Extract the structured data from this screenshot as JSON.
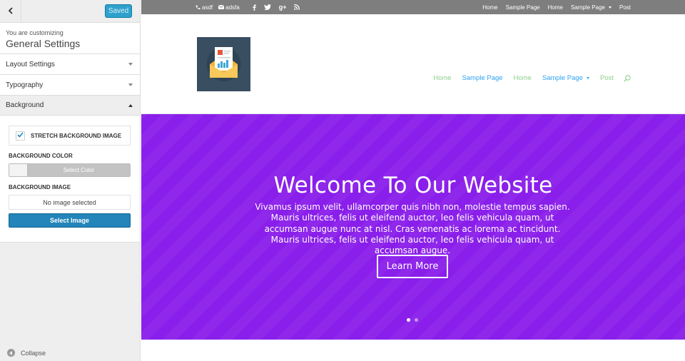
{
  "customizer": {
    "saved_label": "Saved",
    "customizing_label": "You are customizing",
    "customizing_title": "General Settings",
    "sections": [
      {
        "label": "Layout Settings"
      },
      {
        "label": "Typography"
      },
      {
        "label": "Background"
      }
    ],
    "background": {
      "stretch_label": "STRETCH BACKGROUND IMAGE",
      "stretch_checked": true,
      "color_title": "BACKGROUND COLOR",
      "select_color_label": "Select Color",
      "image_title": "BACKGROUND IMAGE",
      "no_image_label": "No image selected",
      "select_image_label": "Select Image"
    },
    "collapse_label": "Collapse"
  },
  "site": {
    "top_bar": {
      "phone": "asdf",
      "email": "adsfa",
      "social_icons": [
        "facebook-icon",
        "twitter-icon",
        "google-plus-icon",
        "rss-icon"
      ],
      "nav": [
        {
          "label": "Home"
        },
        {
          "label": "Sample Page"
        },
        {
          "label": "Home"
        },
        {
          "label": "Sample Page",
          "dropdown": true
        },
        {
          "label": "Post"
        }
      ]
    },
    "main_nav": [
      {
        "label": "Home",
        "color": "green"
      },
      {
        "label": "Sample Page",
        "color": "blue"
      },
      {
        "label": "Home",
        "color": "green"
      },
      {
        "label": "Sample Page",
        "color": "blue",
        "dropdown": true
      },
      {
        "label": "Post",
        "color": "green"
      }
    ],
    "hero": {
      "title": "Welcome To Our Website",
      "text": "Vivamus ipsum velit, ullamcorper quis nibh non, molestie tempus sapien. Mauris ultrices, felis ut eleifend auctor, leo felis vehicula quam, ut accumsan augue nunc at nisl. Cras venenatis ac lorema ac tincidunt. Mauris ultrices, felis ut eleifend auctor, leo felis vehicula quam, ut accumsan augue.",
      "button_label": "Learn More",
      "slide_count": 2,
      "active_slide": 1
    }
  },
  "colors": {
    "accent_blue": "#2ea3f2",
    "nav_green": "#8ccf88",
    "hero_purple": "#8a1eea",
    "topbar_gray": "#7e7e7e",
    "saved_button": "#2ea2cc",
    "select_image_button": "#2385ba"
  }
}
